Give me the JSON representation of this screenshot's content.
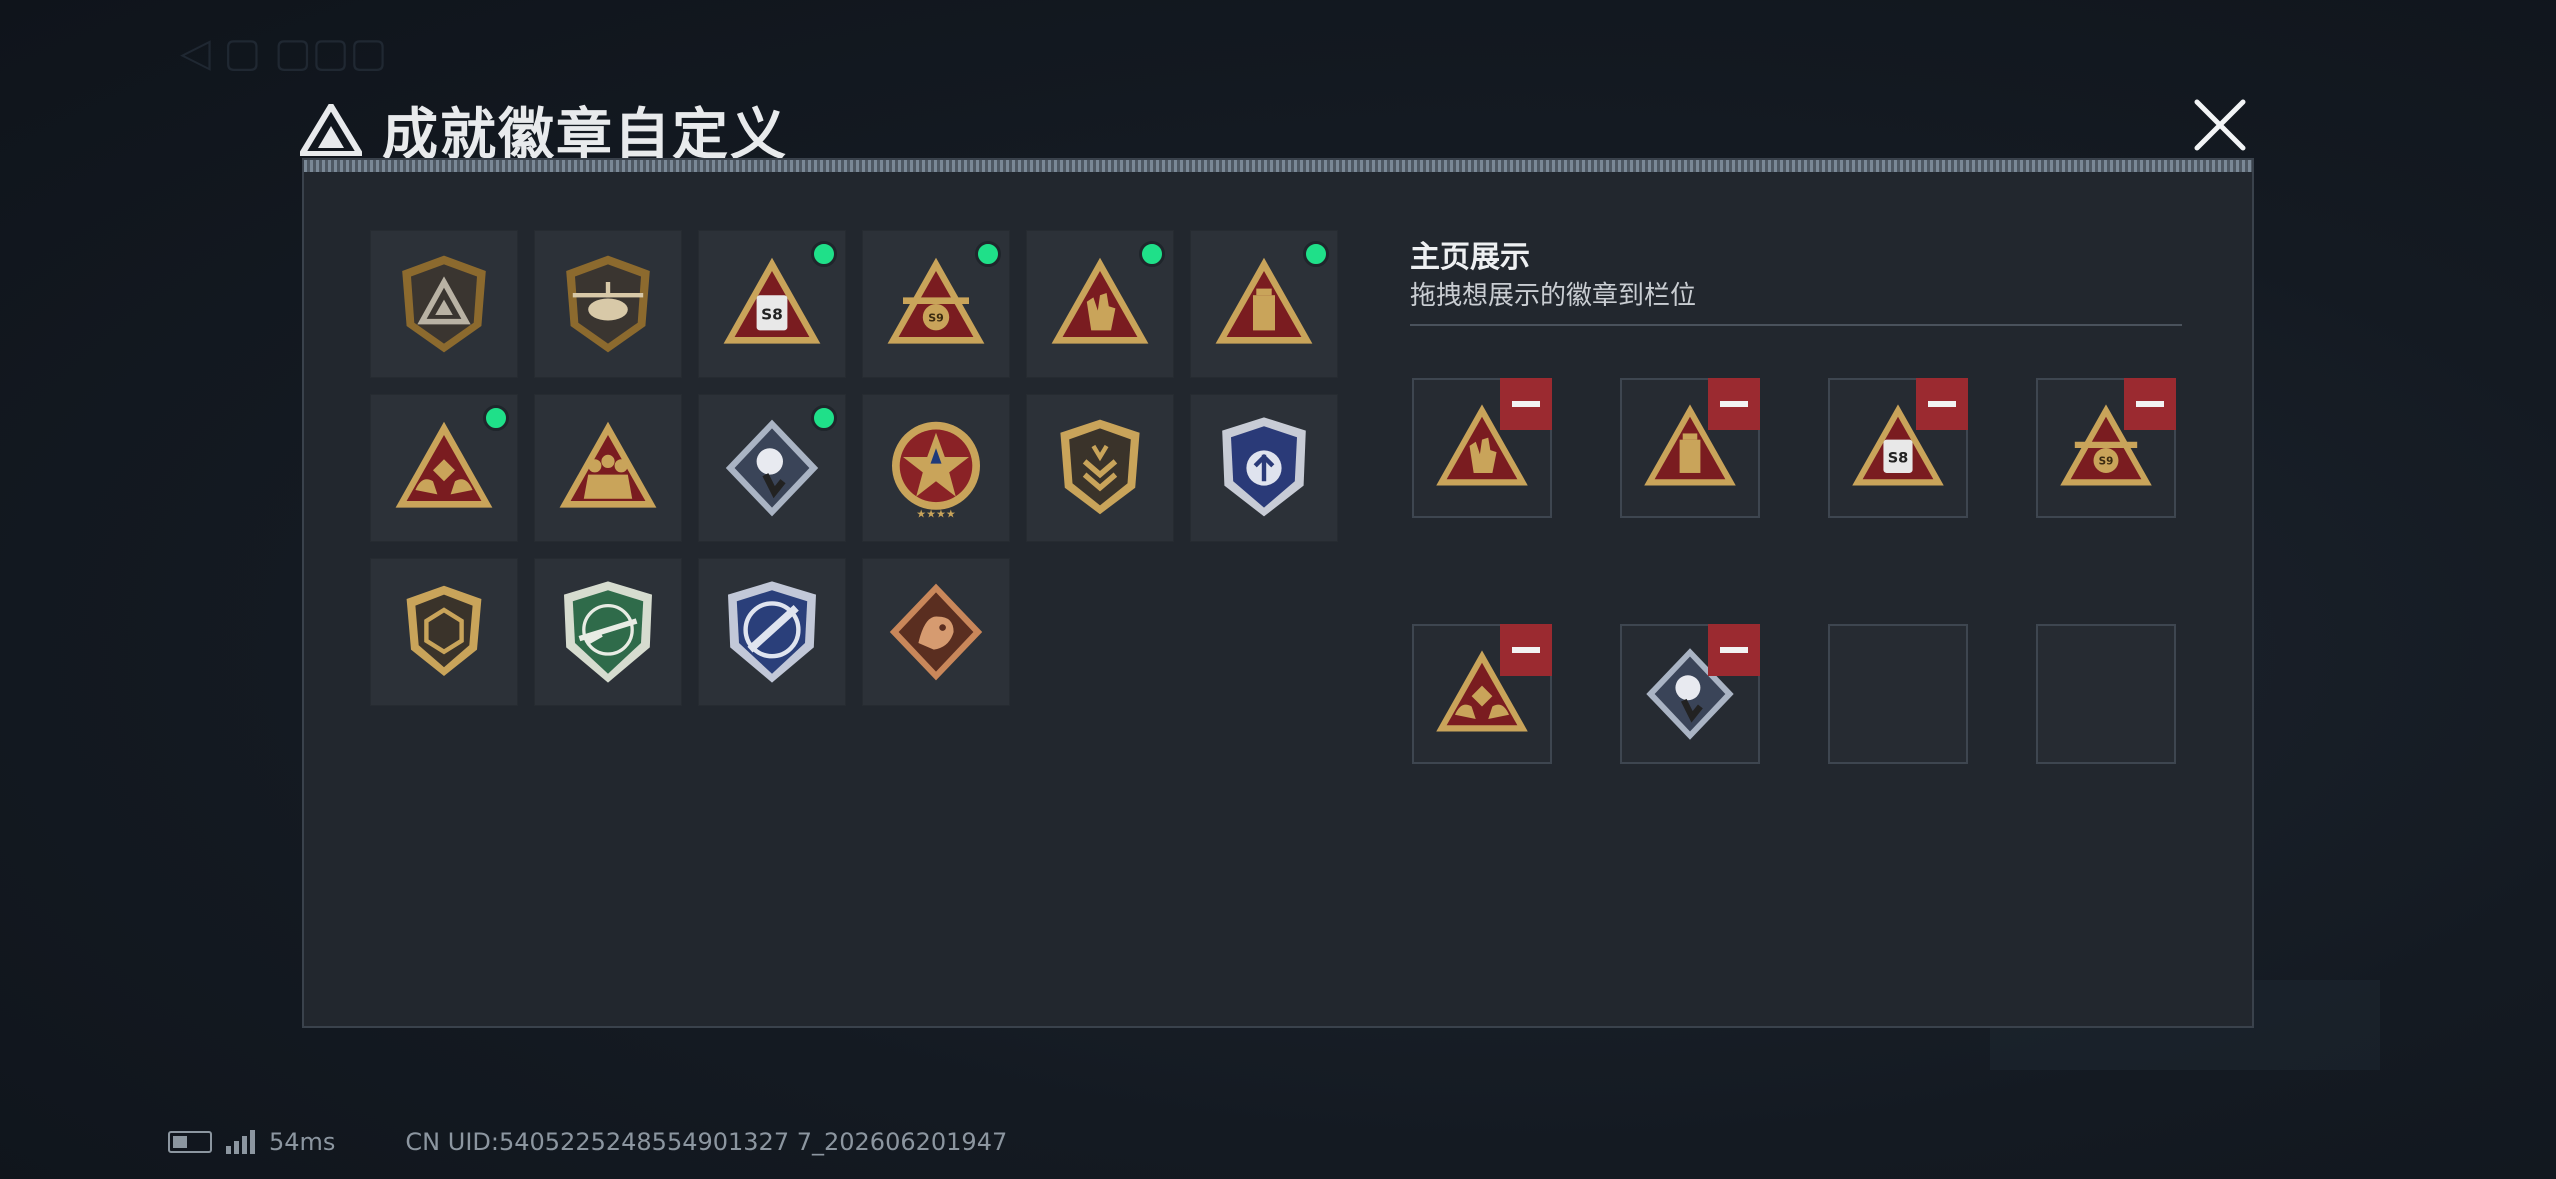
{
  "header": {
    "title": "成就徽章自定义",
    "icon": "triangle-logo-icon",
    "close_icon": "close-icon"
  },
  "badges": [
    {
      "icon": "triangle-shield-badge",
      "new": false
    },
    {
      "icon": "helicopter-badge",
      "new": false
    },
    {
      "icon": "s8-robot-badge",
      "new": true
    },
    {
      "icon": "s9-turret-badge",
      "new": true
    },
    {
      "icon": "hand-sign-badge",
      "new": true
    },
    {
      "icon": "drink-badge",
      "new": true
    },
    {
      "icon": "hands-die-badge",
      "new": true
    },
    {
      "icon": "soldiers-badge",
      "new": false
    },
    {
      "icon": "rose-badge",
      "new": true
    },
    {
      "icon": "star-emblem-badge",
      "new": false
    },
    {
      "icon": "chevron-shield-badge",
      "new": false
    },
    {
      "icon": "blue-wing-shield-badge",
      "new": false
    },
    {
      "icon": "dice-shield-badge",
      "new": false
    },
    {
      "icon": "green-rifle-badge",
      "new": false
    },
    {
      "icon": "blue-knife-badge",
      "new": false
    },
    {
      "icon": "dragon-badge",
      "new": false
    }
  ],
  "homepage": {
    "title": "主页展示",
    "subtitle": "拖拽想展示的徽章到栏位",
    "slots": [
      {
        "icon": "hand-sign-badge",
        "filled": true
      },
      {
        "icon": "drink-badge",
        "filled": true
      },
      {
        "icon": "s8-robot-badge",
        "filled": true
      },
      {
        "icon": "s9-turret-badge",
        "filled": true
      },
      {
        "icon": "hands-die-badge",
        "filled": true
      },
      {
        "icon": "rose-badge",
        "filled": true
      },
      {
        "icon": "",
        "filled": false
      },
      {
        "icon": "",
        "filled": false
      }
    ]
  },
  "status": {
    "ping": "54ms",
    "uid": "CN UID:5405225248554901327 7_202606201947"
  },
  "colors": {
    "new_dot": "#1fe089",
    "remove": "#9b2a30",
    "gold": "#c9a45a",
    "panel": "#22272e"
  }
}
